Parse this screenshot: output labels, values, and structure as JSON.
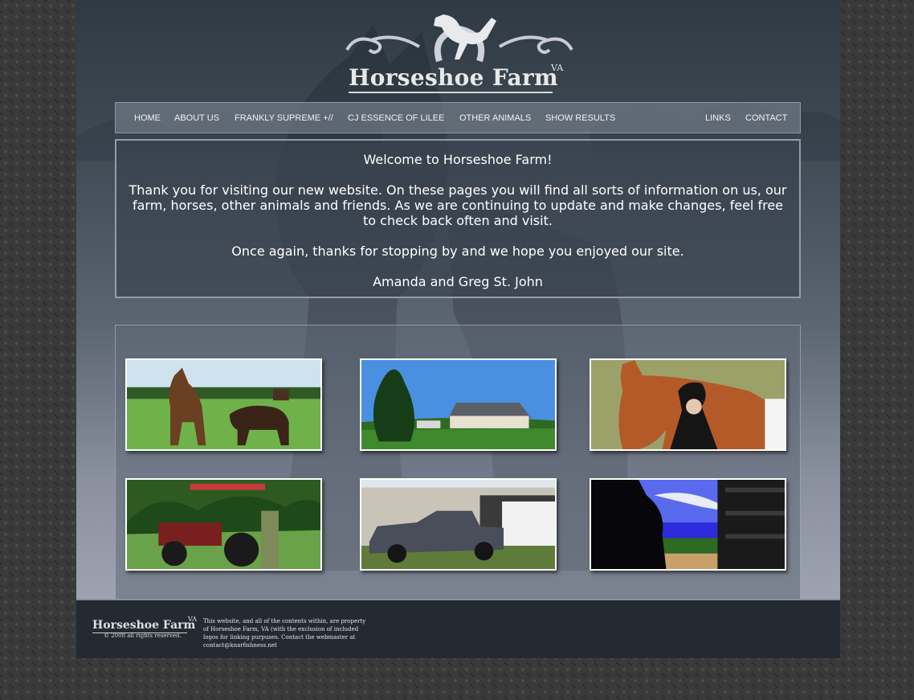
{
  "site": {
    "logo_text": "Horseshoe Farm",
    "logo_suffix": "VA"
  },
  "nav": {
    "items": [
      "HOME",
      "ABOUT US",
      "FRANKLY SUPREME +//",
      "CJ ESSENCE OF LILEE",
      "OTHER ANIMALS",
      "SHOW RESULTS",
      "LINKS",
      "CONTACT"
    ]
  },
  "welcome": {
    "heading": "Welcome to Horseshoe Farm!",
    "paragraph1": "Thank you for visiting our new website. On these pages you will find all sorts of information on us, our farm, horses, other animals and friends. As we are continuing to update and make changes, feel free to check back often and visit.",
    "paragraph2": "Once again, thanks for stopping by and we hope you enjoyed our site.",
    "signature": "Amanda and Greg St. John"
  },
  "gallery": {
    "photos": [
      {
        "subject": "horses-in-pasture"
      },
      {
        "subject": "farm-house"
      },
      {
        "subject": "horse-and-rider"
      },
      {
        "subject": "tractor"
      },
      {
        "subject": "truck-and-trailer"
      },
      {
        "subject": "horse-silhouette"
      }
    ]
  },
  "footer": {
    "logo_text": "Horseshoe Farm",
    "logo_suffix": "VA",
    "copyright": "© 2008 all rights reserved.",
    "notice": "This website, and all of the contents within, are property of Horseshoe Farm, VA (with the exclusion of included logos for linking purpuses. Contact the webmaster at contact@knarfishness.net"
  },
  "colors": {
    "page_top": "#2f3a44",
    "page_bottom": "#9ea3b2",
    "footer_bg": "#232a31",
    "text": "#ffffff"
  }
}
